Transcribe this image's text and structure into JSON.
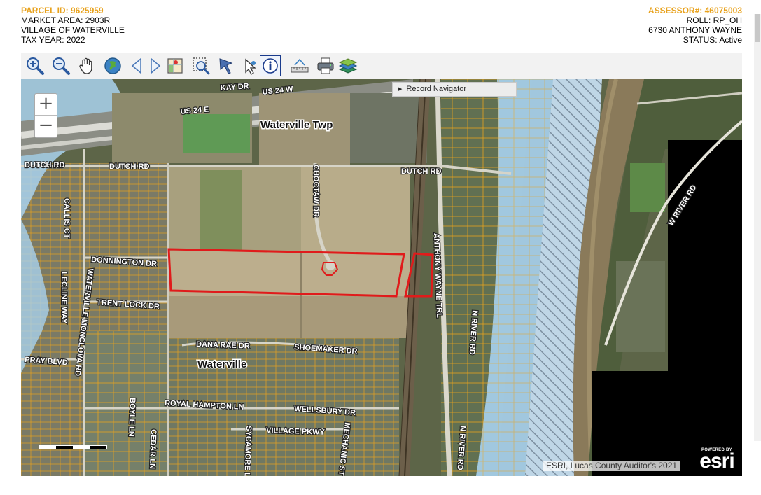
{
  "header": {
    "parcel_id": "PARCEL ID: 9625959",
    "market_area": "MARKET AREA: 2903R",
    "village": "VILLAGE OF WATERVILLE",
    "tax_year": "TAX YEAR: 2022",
    "assessor": "ASSESSOR#: 46075003",
    "roll": "ROLL: RP_OH",
    "address": "6730 ANTHONY WAYNE",
    "status": "STATUS: Active"
  },
  "toolbar": {
    "tools": [
      {
        "name": "zoom-in-tool",
        "icon": "zoom-in-icon"
      },
      {
        "name": "zoom-out-tool",
        "icon": "zoom-out-icon"
      },
      {
        "name": "pan-tool",
        "icon": "hand-icon"
      },
      {
        "name": "full-extent-tool",
        "icon": "globe-icon"
      },
      {
        "name": "previous-extent-tool",
        "icon": "arrow-left-icon"
      },
      {
        "name": "next-extent-tool",
        "icon": "arrow-right-icon"
      },
      {
        "name": "map-tool",
        "icon": "map-icon"
      },
      {
        "name": "zoom-box-tool",
        "icon": "magnify-box-icon"
      },
      {
        "name": "select-tool",
        "icon": "pointer-icon"
      },
      {
        "name": "select-arrow-tool",
        "icon": "select-arrow-icon"
      },
      {
        "name": "identify-tool",
        "icon": "info-icon",
        "active": true
      },
      {
        "name": "measure-tool",
        "icon": "measure-icon"
      },
      {
        "name": "print-tool",
        "icon": "printer-icon"
      },
      {
        "name": "layers-tool",
        "icon": "layers-icon"
      }
    ]
  },
  "map": {
    "zoom_in": "+",
    "zoom_out": "−",
    "record_navigator": "Record Navigator",
    "attribution": "ESRI, Lucas County Auditor's 2021",
    "esri_powered": "POWERED BY",
    "esri_logo": "esri",
    "labels": {
      "kay_dr": "KAY DR",
      "us24w": "US 24 W",
      "us24e": "US 24 E",
      "dutch_rd_1": "DUTCH RD",
      "dutch_rd_2": "DUTCH RD",
      "dutch_rd_3": "DUTCH RD",
      "waterville_twp": "Waterville Twp",
      "choctaw_dr": "CHOCTAW DR",
      "anthony_wayne_trl": "ANTHONY WAYNE TRL",
      "w_river_rd": "W RIVER RD",
      "donnington_dr": "DONNINGTON DR",
      "trent_lock_dr": "TRENT LOCK DR",
      "callis_ct": "CALLIS CT",
      "lecline_way": "LECLINE WAY",
      "waterville_monclova_rd": "WATERVILLE MONCLOVA RD",
      "pray_blvd": "PRAY BLVD",
      "dana_rae_dr": "DANA RAE DR",
      "shoemaker_dr": "SHOEMAKER DR",
      "waterville": "Waterville",
      "royal_hampton_ln": "ROYAL HAMPTON LN",
      "wellsbury_dr": "WELLSBURY DR",
      "village_pkwy": "VILLAGE PKWY",
      "sycamore_ln": "SYCAMORE LN",
      "cedar_ln": "CEDAR LN",
      "boyle_ln": "BOYLE LN",
      "riverside_ln": "N RIVER RD",
      "n_river_rd": "N RIVER RD",
      "mechanic_st": "MECHANIC ST"
    }
  },
  "colors": {
    "parcel_line": "#e8a21d",
    "selected_parcel": "#e01b1b",
    "floodplain": "#a9d2ee",
    "river": "#8a7a5a"
  }
}
